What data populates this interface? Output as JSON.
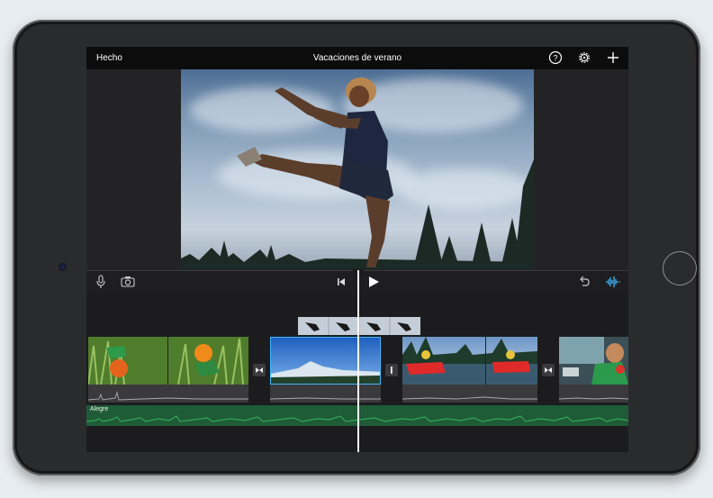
{
  "topbar": {
    "done_label": "Hecho",
    "project_title": "Vacaciones de verano"
  },
  "icons": {
    "help": "help-icon",
    "settings": "gear-icon",
    "add": "plus-icon",
    "mic": "microphone-icon",
    "camera": "camera-icon",
    "skip_back": "skip-back-icon",
    "play": "play-icon",
    "undo": "undo-icon",
    "audio": "audio-waveform-icon"
  },
  "timeline": {
    "music_track_label": "Alegre"
  },
  "colors": {
    "music_track": "#1f5b37",
    "waveform": "#34a65a",
    "accent": "#41b7ff"
  }
}
